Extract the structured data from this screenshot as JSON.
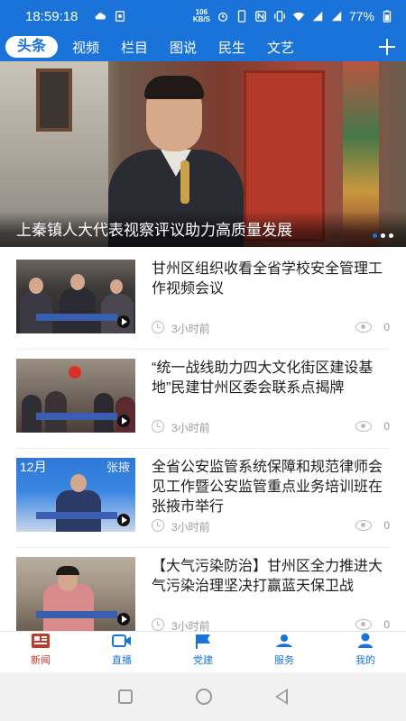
{
  "status": {
    "time": "18:59:18",
    "speed_value": "106",
    "speed_unit": "KB/S",
    "battery": "77%"
  },
  "tabs": [
    {
      "label": "头条",
      "active": true
    },
    {
      "label": "视频"
    },
    {
      "label": "栏目"
    },
    {
      "label": "图说"
    },
    {
      "label": "民生"
    },
    {
      "label": "文艺"
    }
  ],
  "hero": {
    "title": "上秦镇人大代表视察评议助力高质量发展"
  },
  "news": [
    {
      "title": "甘州区组织收看全省学校安全管理工作视频会议",
      "time": "3小时前",
      "views": "0"
    },
    {
      "title": "“统一战线助力四大文化街区建设基地”民建甘州区委会联系点揭牌",
      "time": "3小时前",
      "views": "0"
    },
    {
      "title": "全省公安监管系统保障和规范律师会见工作暨公安监管重点业务培训班在张掖市举行",
      "time": "3小时前",
      "views": "0"
    },
    {
      "title": "【大气污染防治】甘州区全力推进大气污染治理坚决打赢蓝天保卫战",
      "time": "3小时前",
      "views": "0"
    }
  ],
  "thumb_texts": {
    "t3_left": "12月",
    "t3_right": "张掖"
  },
  "bottom_nav": [
    {
      "label": "新闻",
      "active": true,
      "icon": "news-icon"
    },
    {
      "label": "直播",
      "icon": "video-icon"
    },
    {
      "label": "党建",
      "icon": "flag-icon"
    },
    {
      "label": "服务",
      "icon": "service-icon"
    },
    {
      "label": "我的",
      "icon": "user-icon"
    }
  ],
  "colors": {
    "brand": "#1a73d9",
    "nav_active": "#c0392b"
  }
}
